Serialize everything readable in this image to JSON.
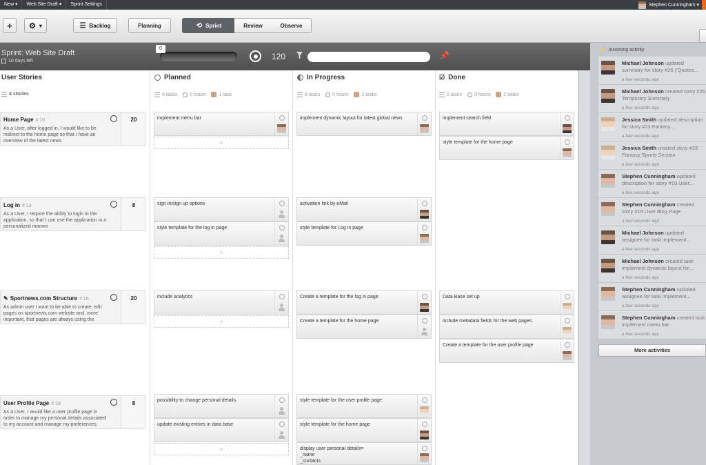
{
  "topbar": {
    "menu": [
      "New ▾",
      "Web Site Draft ▾",
      "Sprint Settings"
    ],
    "user": "Stephen Cunningham ▾"
  },
  "toolbar": {
    "add": "+",
    "settings": "▾",
    "backlog": "Backlog",
    "planning": "Planning",
    "sprint": "Sprint",
    "review": "Review",
    "observe": "Observe"
  },
  "sprint": {
    "title": "Sprint: Web Site Draft",
    "days_left": "10 days left",
    "progress": 0,
    "progress_label": "0",
    "points": "120",
    "filter_placeholder": ""
  },
  "columns": {
    "stories": {
      "title": "User Stories",
      "meta": "4 stories"
    },
    "planned": {
      "title": "Planned",
      "tasks": "6 tasks",
      "hours": "0 hours",
      "owner": "1 task"
    },
    "inprogress": {
      "title": "In Progress",
      "tasks": "8 tasks",
      "hours": "0 hours",
      "owner": "2 tasks"
    },
    "done": {
      "title": "Done",
      "tasks": "5 tasks",
      "hours": "0 hours",
      "owner": "2 tasks"
    }
  },
  "stories": [
    {
      "title": "Home Page",
      "id": "# 10",
      "desc": "As a User, after logged in, I would like to be redirect to the home page so that I have an overview of the latest news",
      "points": "20"
    },
    {
      "title": "Log in",
      "id": "# 13",
      "desc": "As a User, I require the ability to login to the application, so that I can use the application in a personalized manner",
      "points": "8"
    },
    {
      "title": "Sportnews.com Structure",
      "id": "# 16",
      "desc": "As admin user I want to be able to create, edit pages on sportnews.com website and, more important, that pages are always using the",
      "points": "20"
    },
    {
      "title": "User Profile Page",
      "id": "# 18",
      "desc": "As a User, I would like a user profile page in order to manage my personal details associated to my account and manage my preferences, and",
      "points": "8"
    }
  ],
  "tasks": {
    "planned": [
      "implement menu bar",
      "sign in/sign up options",
      "style template for the log in page",
      "include analytics",
      "possibility to change personal details",
      "update existing entries in data base"
    ],
    "inprogress": [
      "implement dynamic layout for latest global news",
      "activation link by eMail",
      "style template for Log in page",
      "Create a template for the log in page",
      "Create a template for the home page",
      "style template for the user profile page",
      "style template for the home page",
      "display user personal details=\n_name\n_contacts"
    ],
    "done": [
      "implement search field",
      "style template for the home page",
      "Data Base set up",
      "include metadata fields for the web pages",
      "Create a template for the user profile page"
    ]
  },
  "activity": {
    "title": "Incoming activity",
    "items": [
      {
        "user": "Michael Johnson",
        "text": "updated summary for story #26 ('Quotes...",
        "when": "a few seconds ago"
      },
      {
        "user": "Michael Johnson",
        "text": "created story #26 Temporary Summary",
        "when": "a few seconds ago"
      },
      {
        "user": "Jessica Smith",
        "text": "updated description for story #23 Fantasy...",
        "when": "a few seconds ago"
      },
      {
        "user": "Jessica Smith",
        "text": "created story #23 Fantasy Sports Section",
        "when": "a few seconds ago"
      },
      {
        "user": "Stephen Cunningham",
        "text": "updated description for story #19 User...",
        "when": "a few seconds ago"
      },
      {
        "user": "Stephen Cunningham",
        "text": "created story #19 User Blog Page",
        "when": "a few seconds ago"
      },
      {
        "user": "Michael Johnson",
        "text": "updated assignee for task implement...",
        "when": "a few seconds ago"
      },
      {
        "user": "Michael Johnson",
        "text": "created task implement dynamic layout for...",
        "when": "a few seconds ago"
      },
      {
        "user": "Stephen Cunningham",
        "text": "updated assignee for task implement...",
        "when": "a few seconds ago"
      },
      {
        "user": "Stephen Cunningham",
        "text": "created task implement menu bar",
        "when": "a few seconds ago"
      }
    ],
    "more": "More activities"
  },
  "colors": {
    "sprint_bar": "#5a5a5a",
    "activity_bg": "#c6c9d0",
    "active_stage": "#5e6166"
  }
}
